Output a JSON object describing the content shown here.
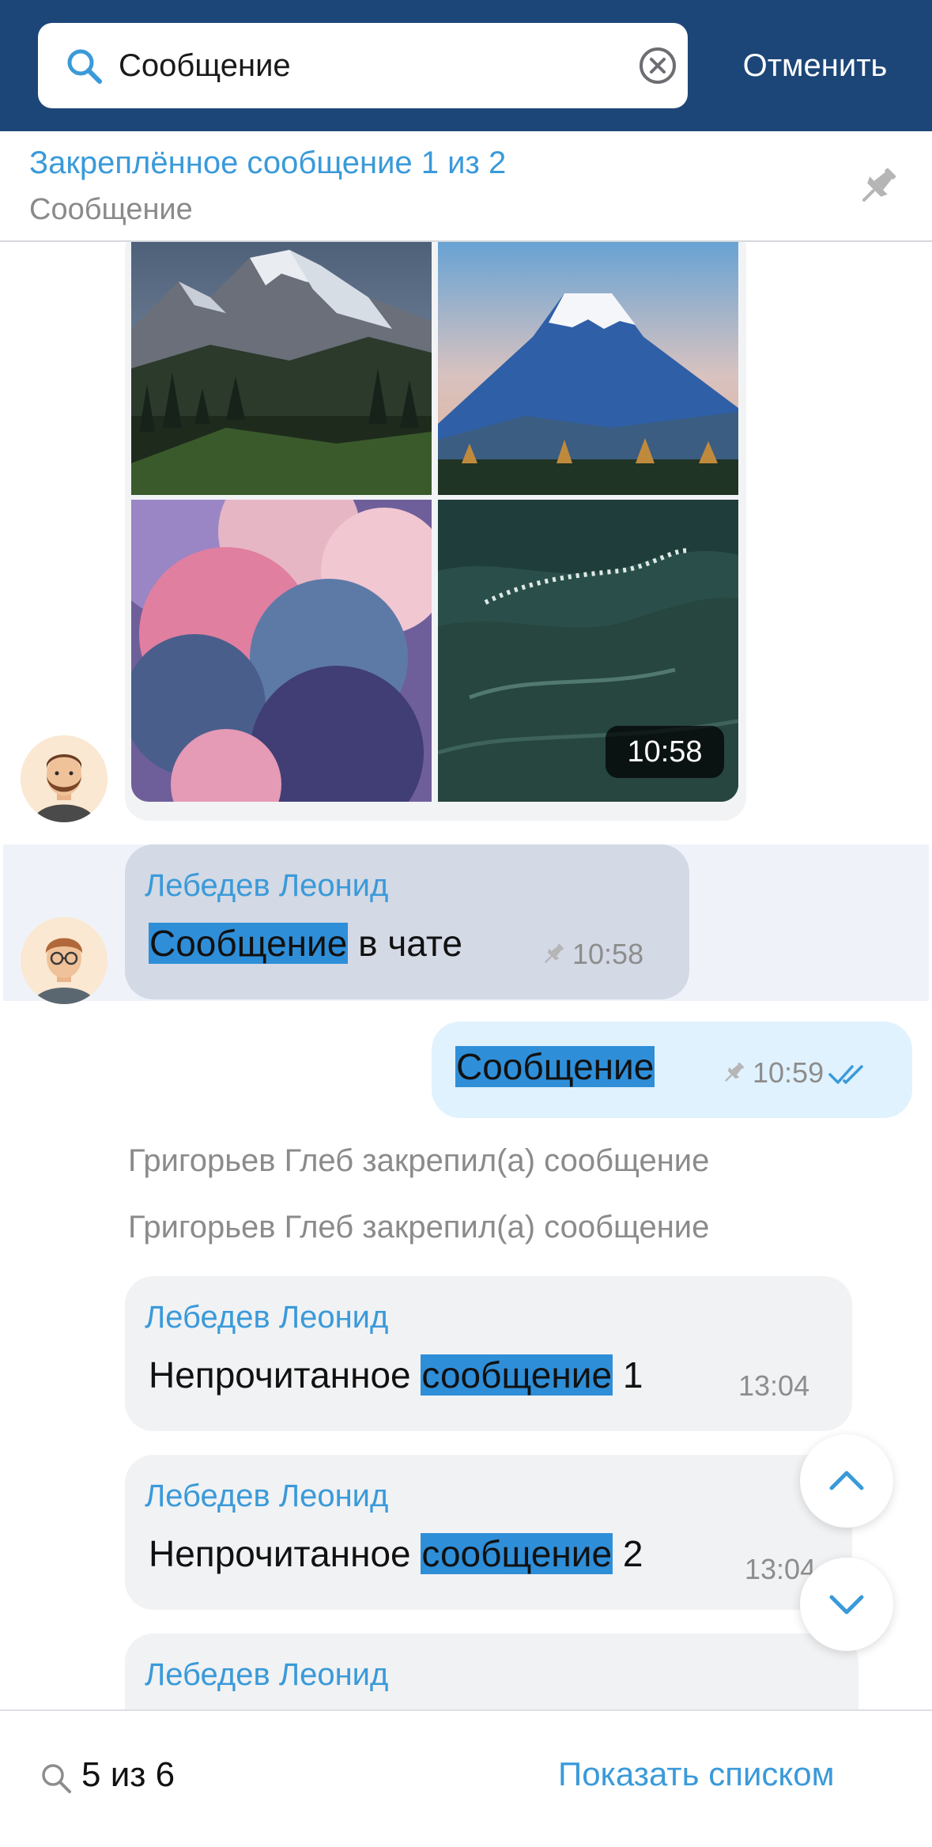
{
  "search": {
    "query": "Сообщение",
    "cancel_label": "Отменить"
  },
  "pinned_bar": {
    "title": "Закреплённое сообщение 1 из 2",
    "preview": "Сообщение"
  },
  "album": {
    "time": "10:58",
    "photos": [
      "mountains-forest",
      "volcano",
      "pink-clouds",
      "sea-waves"
    ]
  },
  "messages": [
    {
      "sender": "Лебедев Леонид",
      "text_match": "Сообщение",
      "text_rest": " в чате",
      "time": "10:58",
      "pinned": true,
      "highlighted": true
    },
    {
      "outgoing": true,
      "text_match": "Сообщение",
      "time": "10:59",
      "pinned": true,
      "status": "read"
    },
    {
      "sender": "Лебедев Леонид",
      "text_pre": "Непрочитанное ",
      "text_match": "сообщение",
      "text_post": " 1",
      "time": "13:04"
    },
    {
      "sender": "Лебедев Леонид",
      "text_pre": "Непрочитанное ",
      "text_match": "сообщение",
      "text_post": " 2",
      "time": "13:04"
    },
    {
      "sender": "Лебедев Леонид"
    }
  ],
  "service_messages": [
    "Григорьев Глеб закрепил(а) сообщение",
    "Григорьев Глеб закрепил(а) сообщение"
  ],
  "bottom_bar": {
    "counter": "5 из 6",
    "show_list_label": "Показать списком"
  },
  "colors": {
    "header": "#1d4678",
    "accent": "#3a9ad9",
    "highlight": "#2f8ed8",
    "outgoing_bubble": "#e0f2fd"
  }
}
